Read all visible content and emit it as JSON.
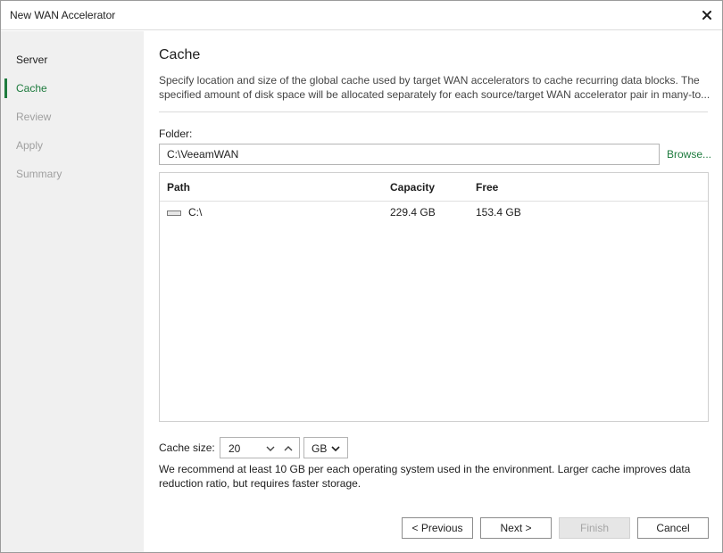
{
  "window": {
    "title": "New WAN Accelerator",
    "close_icon": "close-icon"
  },
  "sidebar": {
    "items": [
      {
        "label": "Server",
        "state": "done"
      },
      {
        "label": "Cache",
        "state": "active"
      },
      {
        "label": "Review",
        "state": "pending"
      },
      {
        "label": "Apply",
        "state": "pending"
      },
      {
        "label": "Summary",
        "state": "pending"
      }
    ]
  },
  "main": {
    "title": "Cache",
    "description_lines": [
      "Specify location and size of the global cache used by target WAN accelerators to cache recurring data blocks. The",
      "specified amount of disk space will be allocated separately for each source/target WAN accelerator pair in many-to..."
    ],
    "folder_label": "Folder:",
    "folder_value": "C:\\VeeamWAN",
    "browse_label": "Browse...",
    "table": {
      "columns": [
        "Path",
        "Capacity",
        "Free"
      ],
      "rows": [
        {
          "path": "C:\\",
          "capacity": "229.4 GB",
          "free": "153.4 GB",
          "icon": "drive-icon"
        }
      ]
    },
    "cache_size_label": "Cache size:",
    "cache_size_value": "20",
    "cache_unit": "GB",
    "recommendation_lines": [
      "We recommend at least 10 GB per each operating system used in the environment. Larger cache improves data",
      "reduction ratio, but requires faster storage."
    ]
  },
  "footer": {
    "previous_label": "< Previous",
    "next_label": "Next >",
    "finish_label": "Finish",
    "cancel_label": "Cancel"
  },
  "colors": {
    "accent": "#1e7b3e",
    "sidebar_bg": "#f0f0f0",
    "disabled_text": "#a0a0a0"
  }
}
